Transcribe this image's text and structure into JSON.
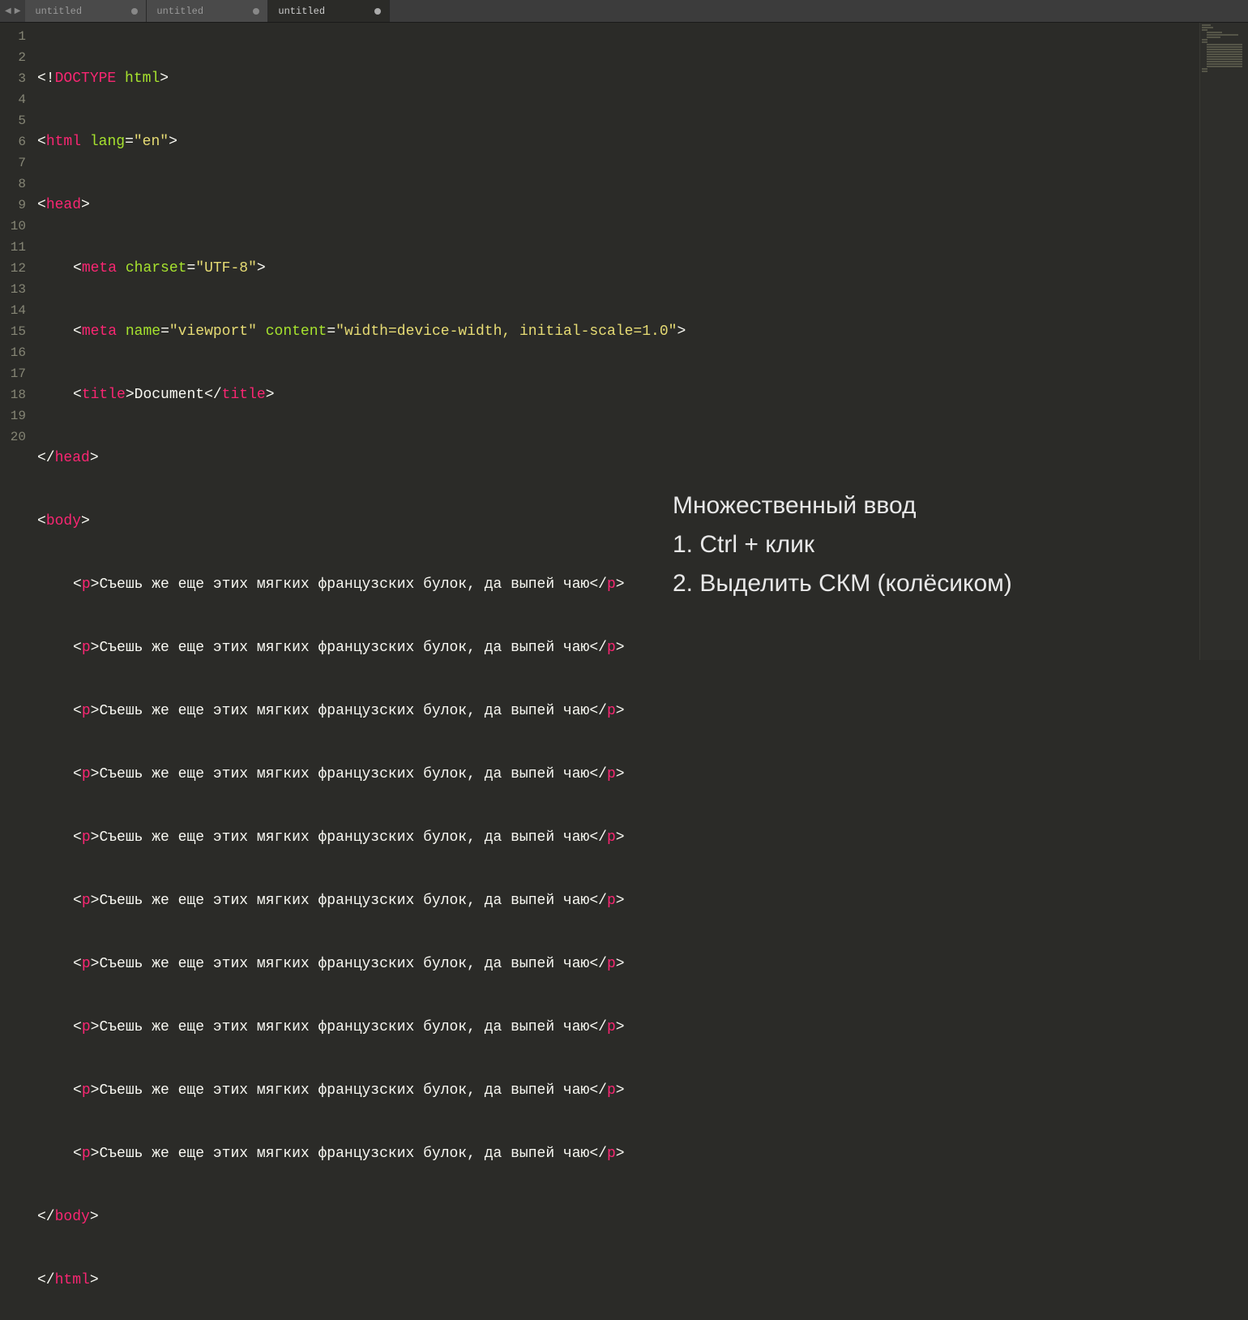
{
  "tabs": [
    {
      "label": "untitled",
      "active": false,
      "dirty": true
    },
    {
      "label": "untitled",
      "active": false,
      "dirty": true
    },
    {
      "label": "untitled",
      "active": true,
      "dirty": true
    }
  ],
  "line_numbers": [
    "1",
    "2",
    "3",
    "4",
    "5",
    "6",
    "7",
    "8",
    "9",
    "10",
    "11",
    "12",
    "13",
    "14",
    "15",
    "16",
    "17",
    "18",
    "19",
    "20"
  ],
  "code": {
    "doctype": {
      "open": "<!",
      "name": "DOCTYPE",
      "attr": "html",
      "close": ">"
    },
    "html_open": {
      "lt": "<",
      "tag": "html",
      "attr_name": "lang",
      "eq": "=",
      "attr_val": "\"en\"",
      "gt": ">"
    },
    "head_open": {
      "lt": "<",
      "tag": "head",
      "gt": ">"
    },
    "meta_charset": {
      "lt": "<",
      "tag": "meta",
      "a1": "charset",
      "eq": "=",
      "v1": "\"UTF-8\"",
      "gt": ">"
    },
    "meta_viewport": {
      "lt": "<",
      "tag": "meta",
      "a1": "name",
      "v1": "\"viewport\"",
      "a2": "content",
      "v2": "\"width=device-width, initial-scale=1.0\"",
      "eq": "=",
      "gt": ">"
    },
    "title": {
      "lt": "<",
      "tag": "title",
      "gt": ">",
      "text": "Document",
      "lt2": "</",
      "gt2": ">"
    },
    "head_close": {
      "lt": "</",
      "tag": "head",
      "gt": ">"
    },
    "body_open": {
      "lt": "<",
      "tag": "body",
      "gt": ">"
    },
    "p_text": "Съешь же еще этих мягких французских булок, да выпей чаю",
    "p_tag": "p",
    "p_lt": "<",
    "p_gt": ">",
    "p_lt2": "</",
    "body_close": {
      "lt": "</",
      "tag": "body",
      "gt": ">"
    },
    "html_close": {
      "lt": "</",
      "tag": "html",
      "gt": ">"
    }
  },
  "overlay": {
    "title": "Множественный ввод",
    "line1": "1. Ctrl + клик",
    "line2": "2. Выделить СКМ (колёсиком)"
  }
}
